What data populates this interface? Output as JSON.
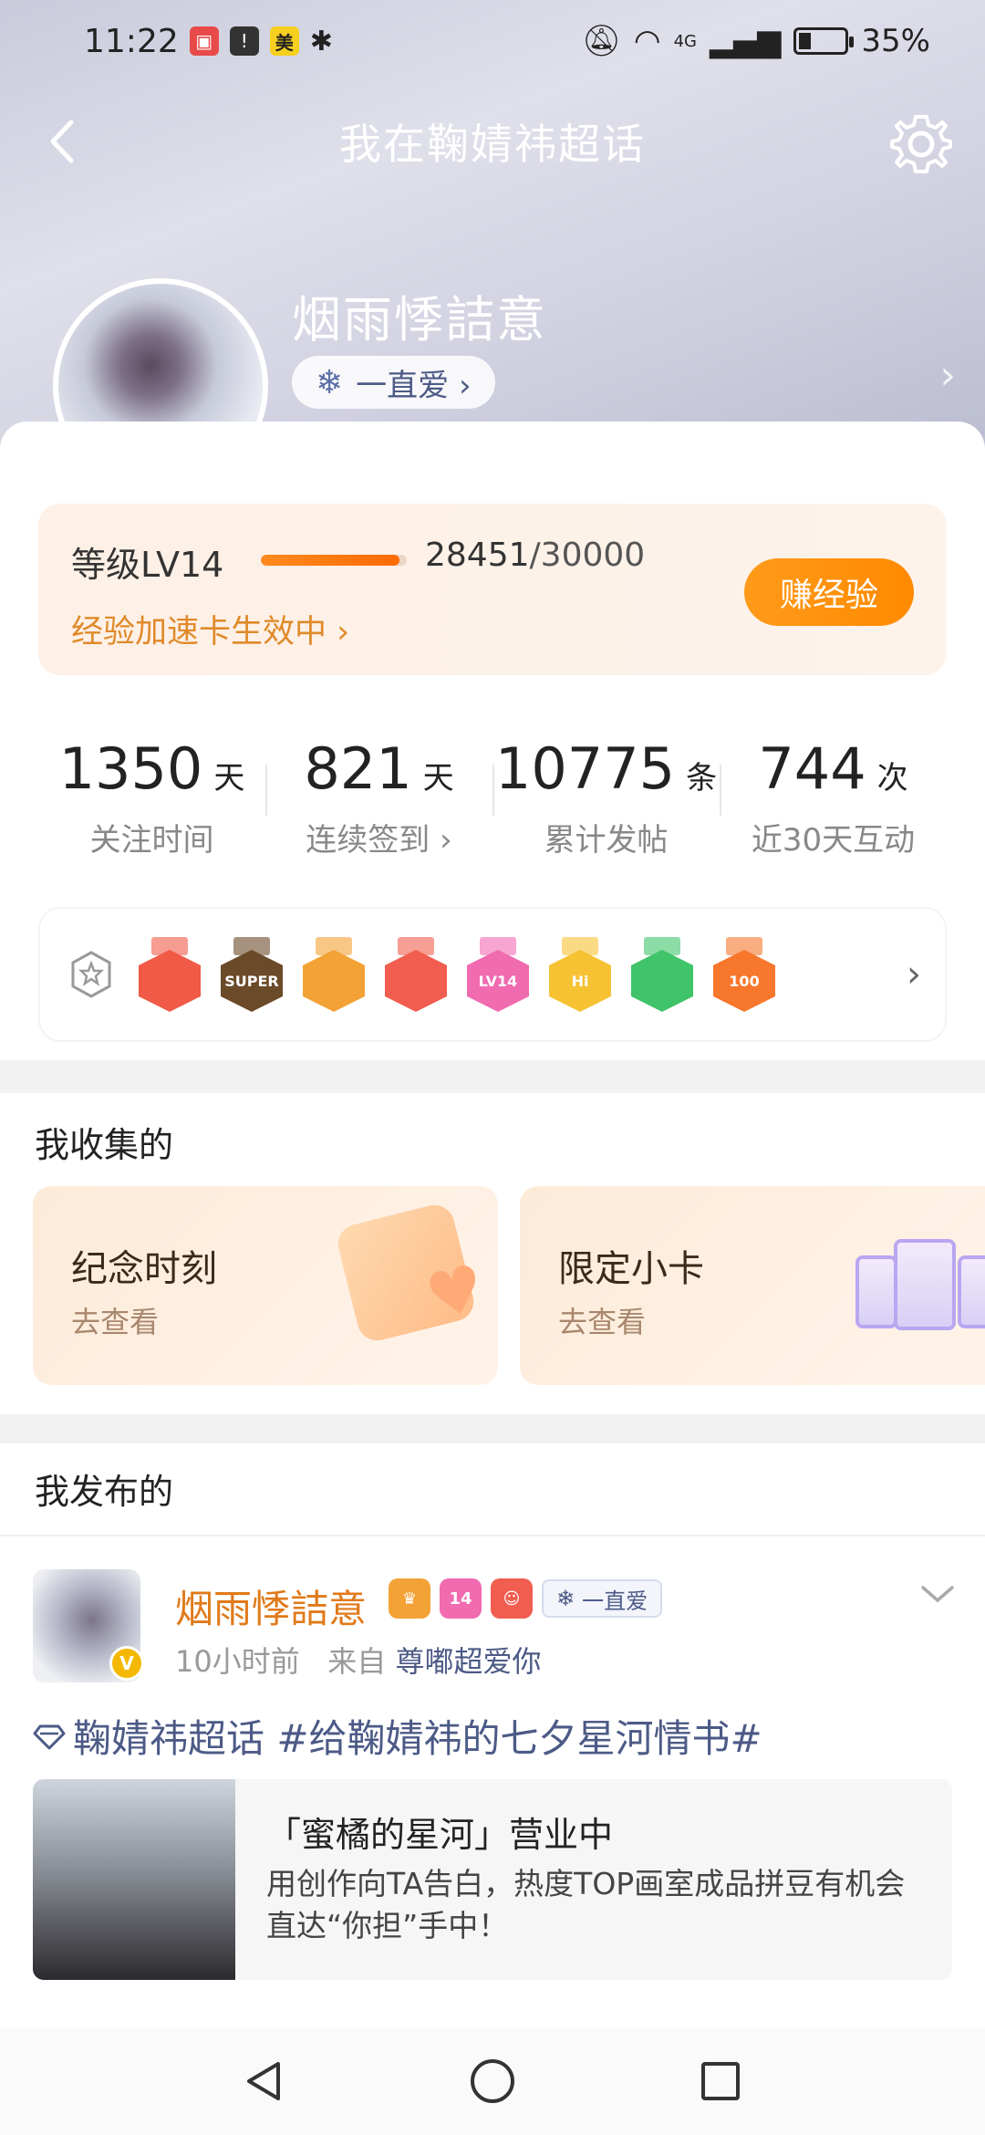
{
  "status_bar": {
    "time": "11:22",
    "app_icon_text": "美",
    "battery_text": "35%",
    "battery_level": 0.35,
    "network": "4G"
  },
  "nav": {
    "title": "我在鞠婧祎超话"
  },
  "profile": {
    "username": "烟雨悸詰意",
    "fan_tag": "一直爱 ›",
    "verified": "V"
  },
  "level": {
    "label": "等级LV14",
    "progress": 0.948,
    "current_exp": "28451",
    "total_exp": "/30000",
    "accel_text": "经验加速卡生效中 ›",
    "earn_button": "赚经验"
  },
  "stats": [
    {
      "value": "1350",
      "unit": "天",
      "label": "关注时间"
    },
    {
      "value": "821",
      "unit": "天",
      "label": "连续签到 ›"
    },
    {
      "value": "10775",
      "unit": "条",
      "label": "累计发帖"
    },
    {
      "value": "744",
      "unit": "次",
      "label": "近30天互动"
    }
  ],
  "badges": {
    "items": [
      {
        "icon": "cat-icon",
        "color": "#f05a46",
        "text": ""
      },
      {
        "icon": "crown-super-icon",
        "color": "#6b4a2a",
        "text": "SUPER"
      },
      {
        "icon": "crown-icon",
        "color": "#f3a236",
        "text": ""
      },
      {
        "icon": "cat-face-icon",
        "color": "#f15d4f",
        "text": ""
      },
      {
        "icon": "lv14-icon",
        "color": "#f06bb0",
        "text": "LV14"
      },
      {
        "icon": "hi-icon",
        "color": "#f6c233",
        "text": "Hi"
      },
      {
        "icon": "hand-icon",
        "color": "#3fc46a",
        "text": ""
      },
      {
        "icon": "100-days-icon",
        "color": "#f7772d",
        "text": "100"
      }
    ]
  },
  "collection": {
    "title": "我收集的",
    "cards": [
      {
        "title": "纪念时刻",
        "subtitle": "去查看"
      },
      {
        "title": "限定小卡",
        "subtitle": "去查看"
      }
    ]
  },
  "posts": {
    "title": "我发布的",
    "item": {
      "author": "烟雨悸詰意",
      "badge_level": "14",
      "fan_tag": "一直爱",
      "time": "10小时前",
      "from_label": "来自",
      "source": "尊嘟超爱你",
      "topic": "鞠婧祎超话 #给鞠婧祎的七夕星河情书#",
      "card_title": "「蜜橘的星河」营业中",
      "card_desc": "用创作向TA告白，热度TOP画室成品拼豆有机会直达“你担”手中！"
    }
  },
  "colors": {
    "accent_orange": "#ff8a00",
    "link_blue": "#4c5a86",
    "author_orange": "#e07a1a"
  }
}
